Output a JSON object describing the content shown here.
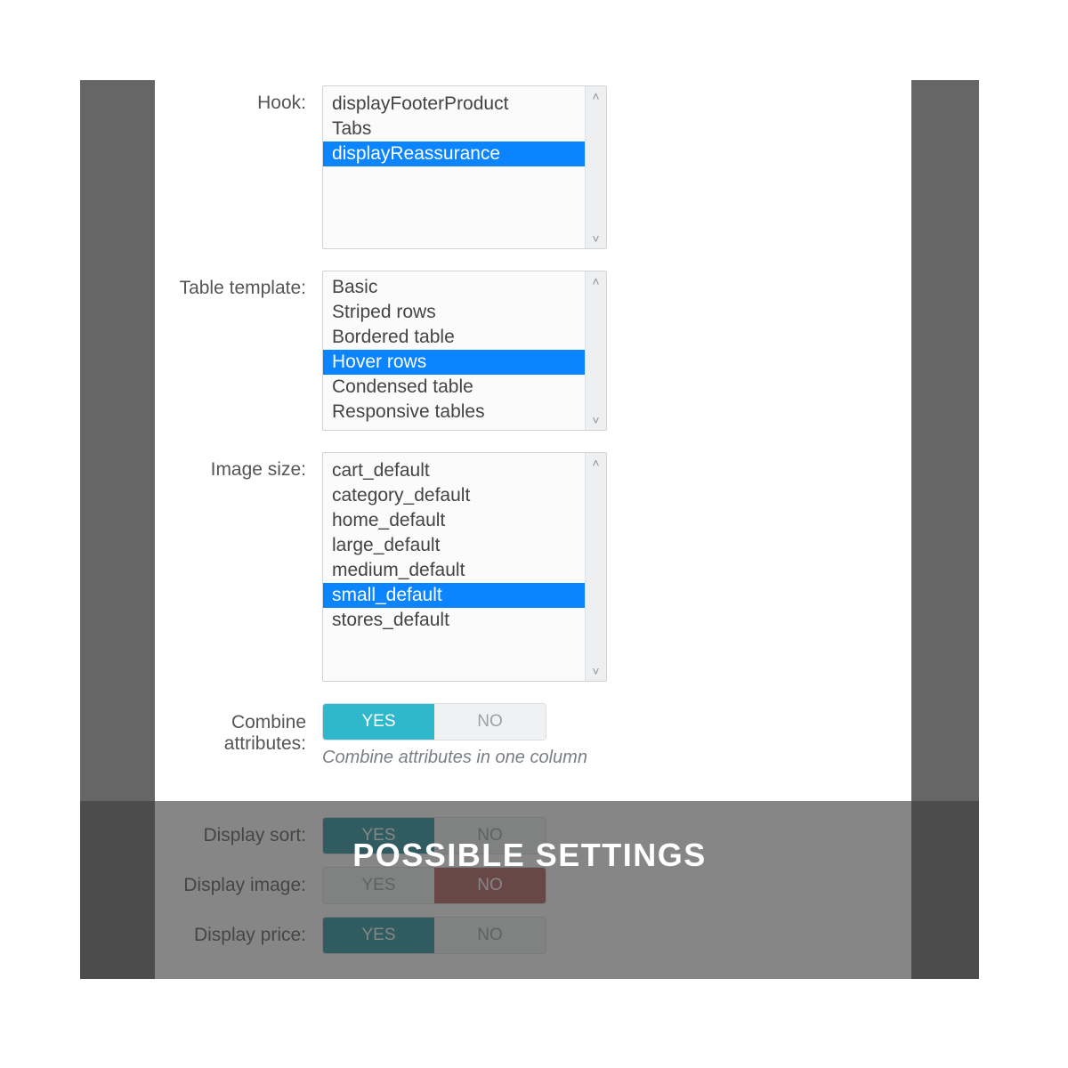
{
  "caption": "POSSIBLE SETTINGS",
  "colors": {
    "accent": "#0a84ff",
    "toggle_on": "#2fb8cc",
    "toggle_off_active": "#b05959",
    "teal_dark": "#1f8f9d"
  },
  "form": {
    "hook": {
      "label": "Hook:",
      "options": [
        "displayFooterProduct",
        "Tabs",
        "displayReassurance"
      ],
      "selected": "displayReassurance"
    },
    "table_template": {
      "label": "Table template:",
      "options": [
        "Basic",
        "Striped rows",
        "Bordered table",
        "Hover rows",
        "Condensed table",
        "Responsive tables"
      ],
      "selected": "Hover rows"
    },
    "image_size": {
      "label": "Image size:",
      "options": [
        "cart_default",
        "category_default",
        "home_default",
        "large_default",
        "medium_default",
        "small_default",
        "stores_default"
      ],
      "selected": "small_default"
    },
    "combine_attributes": {
      "label": "Combine attributes:",
      "yes": "YES",
      "no": "NO",
      "value": "YES",
      "help": "Combine attributes in one column"
    },
    "display_sort": {
      "label": "Display sort:",
      "yes": "YES",
      "no": "NO",
      "value": "YES"
    },
    "display_image": {
      "label": "Display image:",
      "yes": "YES",
      "no": "NO",
      "value": "NO"
    },
    "display_price": {
      "label": "Display price:",
      "yes": "YES",
      "no": "NO",
      "value": "YES"
    }
  }
}
